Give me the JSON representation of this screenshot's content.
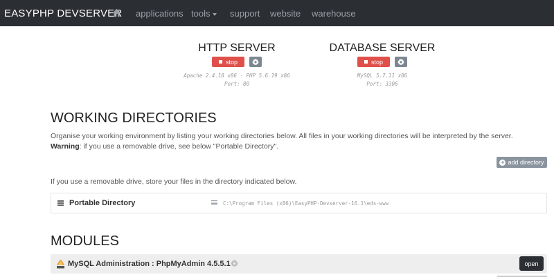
{
  "navbar": {
    "brand": "EASYPHP DEVSERVER",
    "home_icon": "home-icon",
    "items": [
      {
        "label": "applications"
      },
      {
        "label": "tools"
      },
      {
        "label": "support"
      },
      {
        "label": "website"
      },
      {
        "label": "warehouse"
      }
    ]
  },
  "http_server": {
    "title": "HTTP SERVER",
    "stop_label": "stop",
    "info_line1": "Apache 2.4.18 x86 - PHP 5.6.19 x86",
    "info_line2": "Port: 80"
  },
  "database_server": {
    "title": "DATABASE SERVER",
    "stop_label": "stop",
    "info_line1": "MySQL 5.7.11 x86",
    "info_line2": "Port: 3306"
  },
  "working_directories": {
    "heading": "WORKING DIRECTORIES",
    "intro": "Organise your working environment by listing your working directories below. All files in your working directories will be interpreted by the server.",
    "warning_label": "Warning",
    "warning_text": ": if you use a removable drive, see below \"Portable Directory\".",
    "add_button": "add directory",
    "removable_note": "If you use a removable drive, store your files in the directory indicated below.",
    "portable_label": "Portable Directory",
    "portable_path": "C:\\Program Files (x86)\\EasyPHP-Devserver-16.1\\eds-www"
  },
  "modules": {
    "heading": "MODULES",
    "items": [
      {
        "label": "MySQL Administration : PhpMyAdmin 4.5.5.1",
        "open_label": "open"
      }
    ]
  },
  "colors": {
    "navbar_bg": "#2b2e33",
    "stop_red": "#e0504b",
    "gear_gray": "#7d8792",
    "open_dark": "#2b2e33"
  }
}
